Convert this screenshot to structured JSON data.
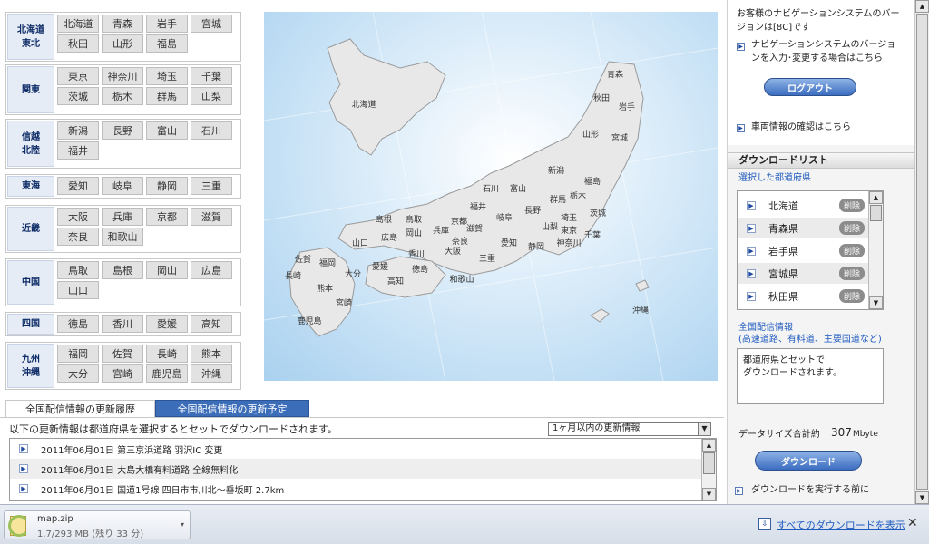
{
  "regions": [
    {
      "label": "北海道\n東北",
      "prefs": [
        "北海道",
        "青森",
        "岩手",
        "宮城",
        "秋田",
        "山形",
        "福島"
      ]
    },
    {
      "label": "関東",
      "prefs": [
        "東京",
        "神奈川",
        "埼玉",
        "千葉",
        "茨城",
        "栃木",
        "群馬",
        "山梨"
      ]
    },
    {
      "label": "信越\n北陸",
      "prefs": [
        "新潟",
        "長野",
        "富山",
        "石川",
        "福井"
      ]
    },
    {
      "label": "東海",
      "prefs": [
        "愛知",
        "岐阜",
        "静岡",
        "三重"
      ]
    },
    {
      "label": "近畿",
      "prefs": [
        "大阪",
        "兵庫",
        "京都",
        "滋賀",
        "奈良",
        "和歌山"
      ]
    },
    {
      "label": "中国",
      "prefs": [
        "鳥取",
        "島根",
        "岡山",
        "広島",
        "山口"
      ]
    },
    {
      "label": "四国",
      "prefs": [
        "徳島",
        "香川",
        "愛媛",
        "高知"
      ]
    },
    {
      "label": "九州\n沖縄",
      "prefs": [
        "福岡",
        "佐賀",
        "長崎",
        "熊本",
        "大分",
        "宮崎",
        "鹿児島",
        "沖縄"
      ]
    }
  ],
  "map": {
    "labels": [
      "北海道",
      "青森",
      "秋田",
      "岩手",
      "山形",
      "宮城",
      "新潟",
      "福島",
      "石川",
      "富山",
      "群馬",
      "栃木",
      "茨城",
      "長野",
      "埼玉",
      "東京",
      "千葉",
      "山梨",
      "神奈川",
      "静岡",
      "愛知",
      "岐阜",
      "福井",
      "滋賀",
      "京都",
      "三重",
      "奈良",
      "大阪",
      "和歌山",
      "兵庫",
      "島根",
      "鳥取",
      "岡山",
      "広島",
      "山口",
      "香川",
      "徳島",
      "愛媛",
      "高知",
      "福岡",
      "佐賀",
      "長崎",
      "熊本",
      "大分",
      "宮崎",
      "鹿児島",
      "沖縄"
    ]
  },
  "tabs": {
    "history": "全国配信情報の更新履歴",
    "schedule": "全国配信情報の更新予定"
  },
  "updates": {
    "note": "以下の更新情報は都道府県を選択するとセットでダウンロードされます。",
    "filter": "1ヶ月以内の更新情報",
    "rows": [
      "2011年06月01日 第三京浜道路 羽沢IC 変更",
      "2011年06月01日 大島大橋有料道路 全線無料化",
      "2011年06月01日 国道1号線 四日市市川北～垂坂町 2.7km"
    ]
  },
  "account": {
    "version_text_1": "お客様のナビゲーションシステムのバー",
    "version_text_2": "ジョンは[8C]です",
    "version_link_1": "ナビゲーションシステムのバージョ",
    "version_link_2": "ンを入力･変更する場合はこちら",
    "logout": "ログアウト",
    "vehicle_link": "車両情報の確認はこちら"
  },
  "download_list": {
    "heading": "ダウンロードリスト",
    "subheading": "選択した都道府県",
    "items": [
      "北海道",
      "青森県",
      "岩手県",
      "宮城県",
      "秋田県"
    ],
    "delete_label": "削除",
    "national_title": "全国配信情報",
    "national_sub": "(高速道路、有料道、主要国道など)",
    "national_note_1": "都道府県とセットで",
    "national_note_2": "ダウンロードされます。",
    "size_label": "データサイズ合計約",
    "size_value": "307",
    "size_unit": "Mbyte",
    "download_button": "ダウンロード",
    "before_link": "ダウンロードを実行する前に"
  },
  "browser_download": {
    "filename": "map.zip",
    "status": "1.7/293 MB (残り 33 分)",
    "show_all": "すべてのダウンロードを表示"
  }
}
